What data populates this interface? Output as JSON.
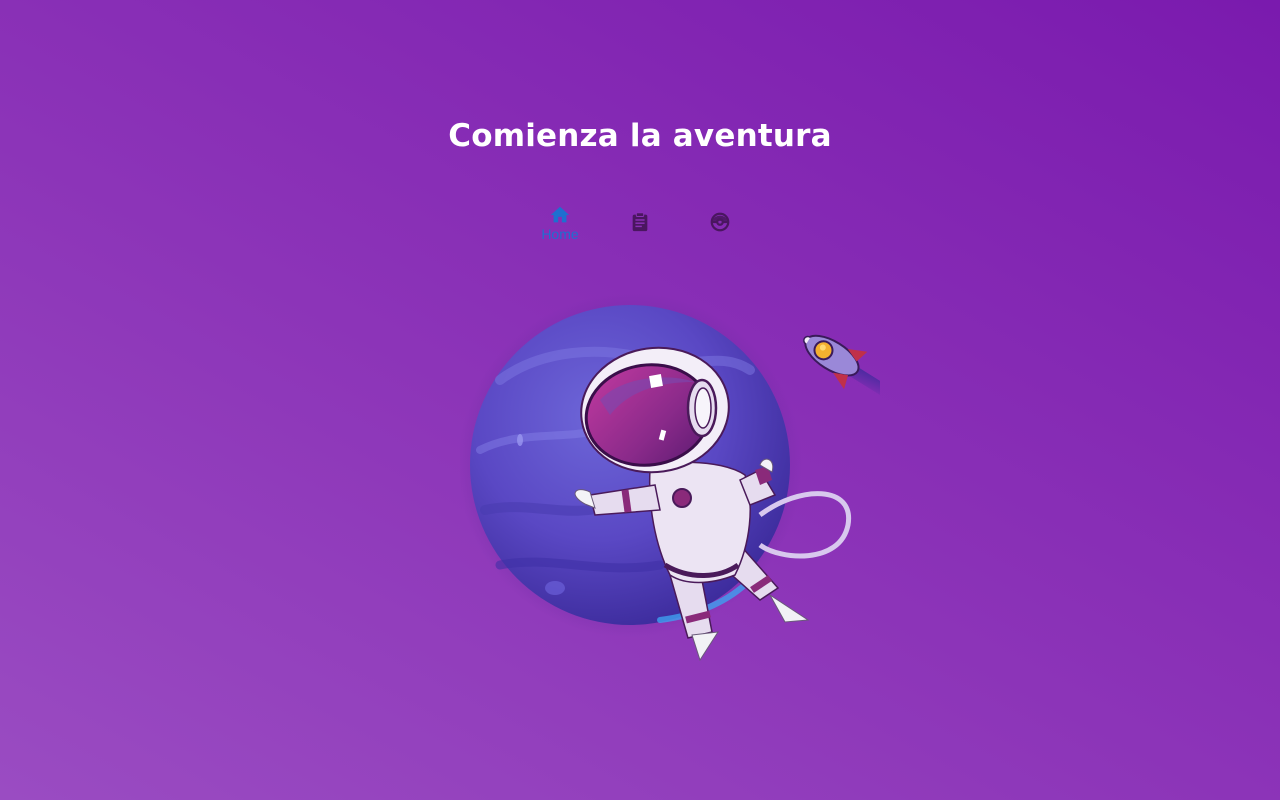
{
  "page": {
    "title": "Comienza la aventura"
  },
  "nav": {
    "items": [
      {
        "label": "Home",
        "icon": "home-icon",
        "active": true
      },
      {
        "label": "",
        "icon": "clipboard-icon",
        "active": false
      },
      {
        "label": "",
        "icon": "pokeball-icon",
        "active": false
      }
    ]
  },
  "illustration": {
    "subject": "astronaut-planet-rocket"
  },
  "colors": {
    "background_start": "#9a4cc2",
    "background_end": "#7a1aae",
    "title": "#ffffff",
    "nav_active": "#1e6fd0",
    "nav_inactive": "#4a1660"
  }
}
